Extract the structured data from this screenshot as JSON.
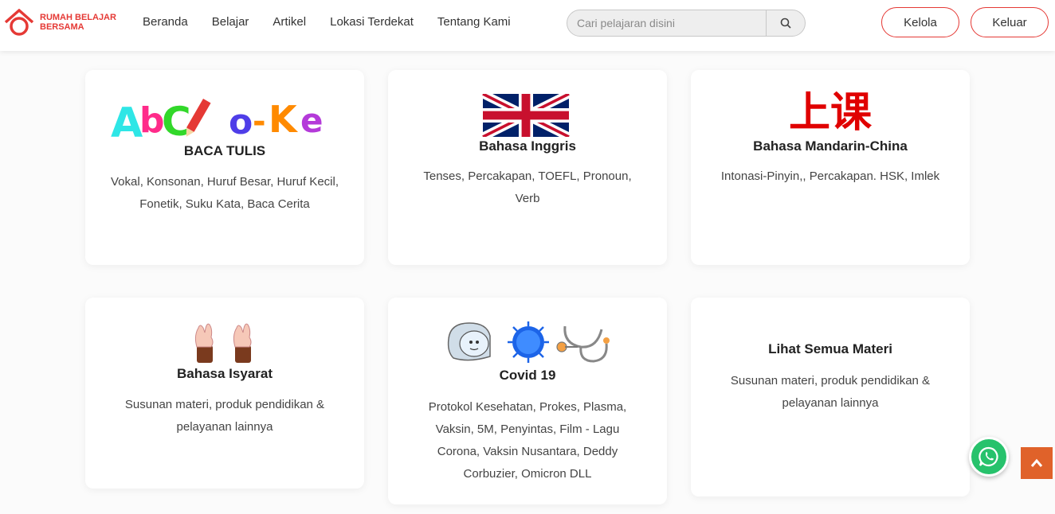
{
  "header": {
    "logo_line1": "RUMAH BELAJAR",
    "logo_line2": "BERSAMA",
    "brand_color": "#e53935",
    "nav_items": [
      "Beranda",
      "Belajar",
      "Artikel",
      "Lokasi Terdekat",
      "Tentang Kami"
    ],
    "search_placeholder": "Cari pelajaran disini",
    "manage_button": "Kelola",
    "logout_button": "Keluar"
  },
  "cards": [
    {
      "icon_text": "AbC Lo-Ke",
      "title": "BACA TULIS",
      "desc": "Vokal, Konsonan, Huruf Besar, Huruf Kecil, Fonetik, Suku Kata, Baca Cerita"
    },
    {
      "icon": "uk-flag-icon",
      "title": "Bahasa Inggris",
      "desc": "Tenses, Percakapan, TOEFL, Pronoun, Verb"
    },
    {
      "icon_text": "上课",
      "title": "Bahasa Mandarin-China",
      "desc": "Intonasi-Pinyin,, Percakapan. HSK, Imlek"
    },
    {
      "icon": "sign-language-hands-icon",
      "title": "Bahasa Isyarat",
      "desc": "Susunan materi, produk pendidikan & pelayanan lainnya"
    },
    {
      "icon": "covid-icons",
      "title": "Covid 19",
      "desc": "Protokol Kesehatan, Prokes, Plasma, Vaksin, 5M, Penyintas, Film - Lagu Corona, Vaksin Nusantara, Deddy Corbuzier, Omicron DLL"
    },
    {
      "title": "Lihat Semua Materi",
      "desc": "Susunan materi, produk pendidikan & pelayanan lainnya"
    }
  ],
  "floating": {
    "whatsapp_icon": "whatsapp-icon",
    "top_icon": "chevron-up-icon",
    "whatsapp_color": "#27c26c",
    "top_color": "#e0622a"
  }
}
